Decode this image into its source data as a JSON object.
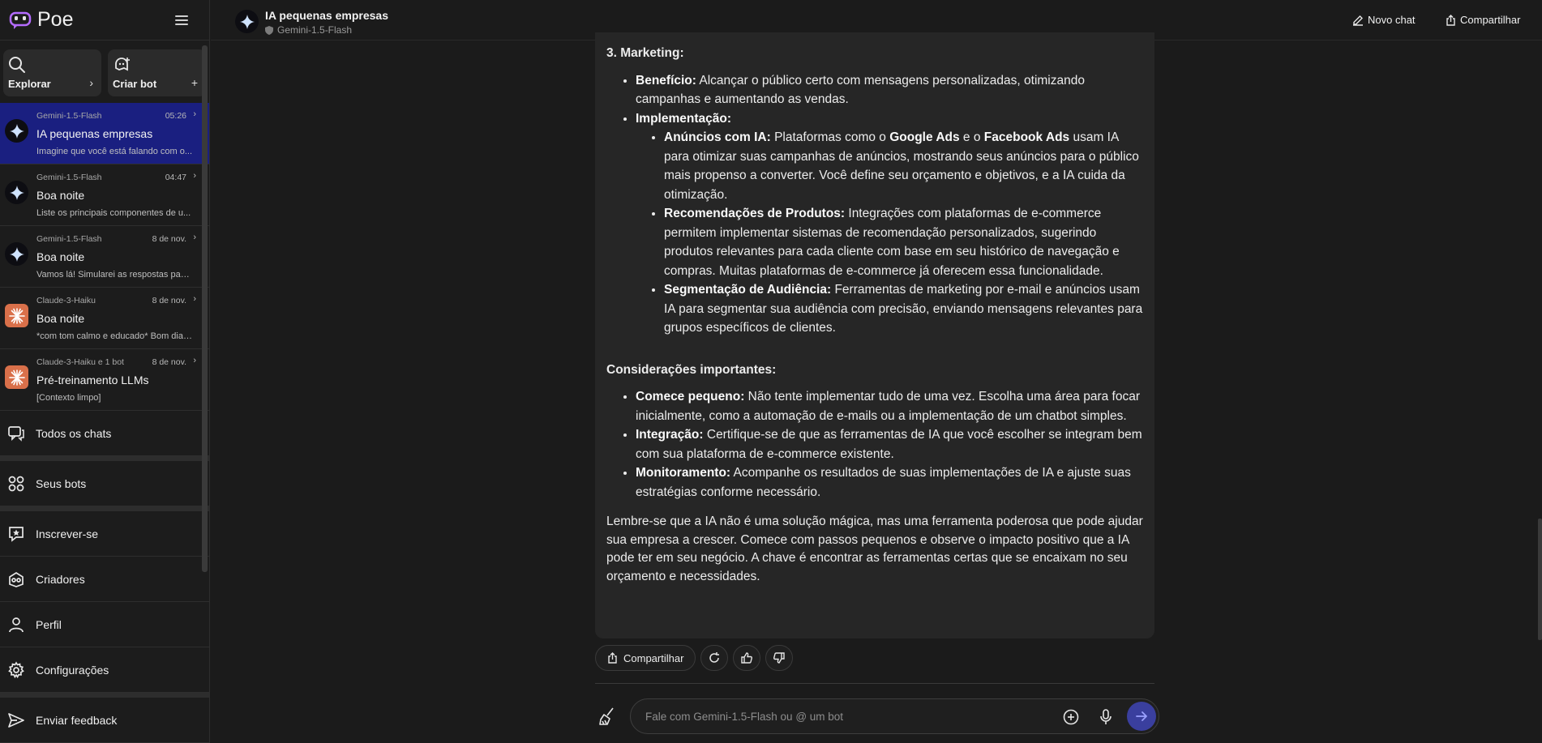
{
  "app": {
    "name": "Poe"
  },
  "sidebar": {
    "explore_label": "Explorar",
    "create_bot_label": "Criar bot",
    "chats": [
      {
        "bot": "Gemini-1.5-Flash",
        "time": "05:26",
        "title": "IA pequenas empresas",
        "preview": "Imagine que você está falando com o...",
        "avatar": "gemini",
        "active": true
      },
      {
        "bot": "Gemini-1.5-Flash",
        "time": "04:47",
        "title": "Boa noite",
        "preview": "Liste os principais componentes de u...",
        "avatar": "gemini"
      },
      {
        "bot": "Gemini-1.5-Flash",
        "time": "8 de nov.",
        "title": "Boa noite",
        "preview": "Vamos lá! Simularei as respostas para ...",
        "avatar": "gemini"
      },
      {
        "bot": "Claude-3-Haiku",
        "time": "8 de nov.",
        "title": "Boa noite",
        "preview": "*com tom calmo e educado* Bom dia,...",
        "avatar": "claude"
      },
      {
        "bot": "Claude-3-Haiku e 1 bot",
        "time": "8 de nov.",
        "title": "Pré-treinamento LLMs",
        "preview": "[Contexto limpo]",
        "avatar": "claude"
      }
    ],
    "nav": {
      "all_chats": "Todos os chats",
      "your_bots": "Seus bots",
      "subscribe": "Inscrever-se",
      "creators": "Criadores",
      "profile": "Perfil",
      "settings": "Configurações",
      "feedback": "Enviar feedback"
    }
  },
  "header": {
    "title": "IA pequenas empresas",
    "subtitle": "Gemini-1.5-Flash",
    "new_chat": "Novo chat",
    "share": "Compartilhar"
  },
  "message": {
    "marketing_heading": "3. Marketing:",
    "m_benefit_label": "Benefício:",
    "m_benefit_text": " Alcançar o público certo com mensagens personalizadas, otimizando campanhas e aumentando as vendas.",
    "m_impl_label": "Implementação:",
    "ads_label": "Anúncios com IA:",
    "ads_t1": " Plataformas como o ",
    "ads_google": "Google Ads",
    "ads_t2": " e o ",
    "ads_facebook": "Facebook Ads",
    "ads_t3": " usam IA para otimizar suas campanhas de anúncios, mostrando seus anúncios para o público mais propenso a converter. Você define seu orçamento e objetivos, e a IA cuida da otimização.",
    "rec_label": "Recomendações de Produtos:",
    "rec_text": " Integrações com plataformas de e-commerce permitem implementar sistemas de recomendação personalizados, sugerindo produtos relevantes para cada cliente com base em seu histórico de navegação e compras. Muitas plataformas de e-commerce já oferecem essa funcionalidade.",
    "seg_label": "Segmentação de Audiência:",
    "seg_text": " Ferramentas de marketing por e-mail e anúncios usam IA para segmentar sua audiência com precisão, enviando mensagens relevantes para grupos específicos de clientes.",
    "considerations_heading": "Considerações importantes:",
    "c1_label": "Comece pequeno:",
    "c1_text": " Não tente implementar tudo de uma vez. Escolha uma área para focar inicialmente, como a automação de e-mails ou a implementação de um chatbot simples.",
    "c2_label": "Integração:",
    "c2_text": " Certifique-se de que as ferramentas de IA que você escolher se integram bem com sua plataforma de e-commerce existente.",
    "c3_label": "Monitoramento:",
    "c3_text": " Acompanhe os resultados de suas implementações de IA e ajuste suas estratégias conforme necessário.",
    "closing": "Lembre-se que a IA não é uma solução mágica, mas uma ferramenta poderosa que pode ajudar sua empresa a crescer. Comece com passos pequenos e observe o impacto positivo que a IA pode ter em seu negócio. A chave é encontrar as ferramentas certas que se encaixam no seu orçamento e necessidades."
  },
  "message_actions": {
    "share": "Compartilhar"
  },
  "composer": {
    "placeholder": "Fale com Gemini-1.5-Flash ou @ um bot"
  },
  "colors": {
    "active_chat": "#1a1f80",
    "send_button": "#3a3f9e",
    "claude_avatar": "#d9704a"
  },
  "icons": [
    "poe-logo-icon",
    "menu-icon",
    "search-icon",
    "add-bot-icon",
    "plus-icon",
    "chevron-right-icon",
    "gemini-star-icon",
    "claude-starburst-icon",
    "chats-icon",
    "bots-icon",
    "subscribe-icon",
    "creators-icon",
    "profile-icon",
    "gear-icon",
    "send-icon",
    "shield-icon",
    "edit-icon",
    "share-icon",
    "refresh-icon",
    "thumbs-up-icon",
    "thumbs-down-icon",
    "broom-icon",
    "add-circle-icon",
    "microphone-icon",
    "arrow-right-icon"
  ]
}
